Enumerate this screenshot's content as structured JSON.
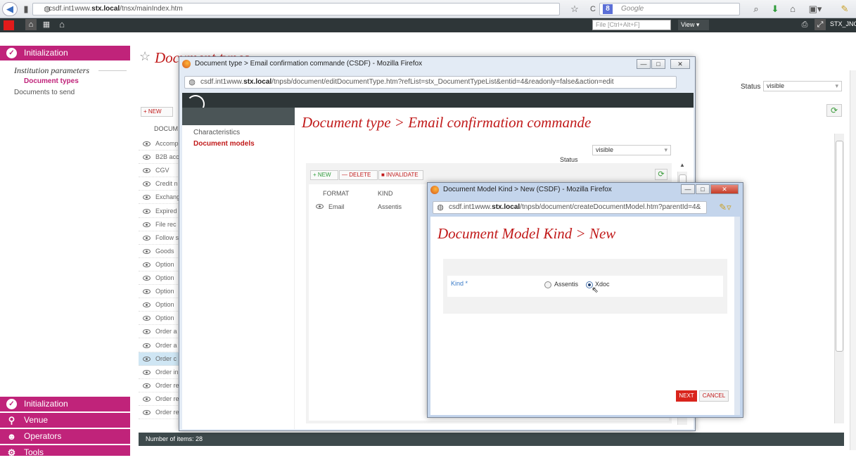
{
  "browser": {
    "url_prefix": "csdf.int1www.",
    "url_host": "stx.local",
    "url_path": "/tnsx/mainIndex.htm",
    "search_engine": "8",
    "search_placeholder": "Google",
    "star": "☆",
    "reload": "C"
  },
  "topbar": {
    "search_placeholder": "File [Ctrl+Alt+F]",
    "view_label": "View ▾",
    "user_label": "STX_JNO ▾"
  },
  "sidebar": {
    "section_title": "Initialization",
    "group_title": "Institution parameters",
    "items": [
      {
        "label": "Document types",
        "active": true
      },
      {
        "label": "Documents to send",
        "active": false
      }
    ],
    "bottom_sections": [
      "Initialization",
      "Venue",
      "Operators",
      "Tools"
    ]
  },
  "main": {
    "title": "Document types",
    "status_label": "Status",
    "status_value": "visible",
    "new_label": "+ NEW",
    "column_header": "DOCUM",
    "rows": [
      "Accomp",
      "B2B acc",
      "CGV",
      "Credit n",
      "Exchang",
      "Expired",
      "File rec",
      "Follow s",
      "Goods",
      "Option",
      "Option",
      "Option",
      "Option",
      "Option",
      "Order a",
      "Order a",
      "Order c",
      "Order in",
      "Order re",
      "Order re",
      "Order re"
    ],
    "footer": "Number of items: 28"
  },
  "window1": {
    "title": "Document type > Email confirmation commande (CSDF) - Mozilla Firefox",
    "url_prefix": "csdf.int1www.",
    "url_host": "stx.local",
    "url_path": "/tnpsb/document/editDocumentType.htm?refList=stx_DocumentTypeList&entid=4&readonly=false&action=edit",
    "nav": [
      {
        "label": "Characteristics",
        "active": false
      },
      {
        "label": "Document models",
        "active": true
      }
    ],
    "heading": "Document type > Email confirmation commande",
    "status_label": "Status",
    "status_value": "visible",
    "buttons": {
      "new": "+ NEW",
      "delete": "— DELETE",
      "invalidate": "■ INVALIDATE"
    },
    "columns": [
      "FORMAT",
      "KIND"
    ],
    "rows": [
      {
        "format": "Email",
        "kind": "Assentis"
      }
    ]
  },
  "window2": {
    "title": "Document Model Kind > New (CSDF) - Mozilla Firefox",
    "url_prefix": "csdf.int1www.",
    "url_host": "stx.local",
    "url_path": "/tnpsb/document/createDocumentModel.htm?parentId=4&",
    "heading": "Document Model Kind > New",
    "field_label": "Kind *",
    "options": [
      {
        "label": "Assentis",
        "checked": false
      },
      {
        "label": "Xdoc",
        "checked": true
      }
    ],
    "next_label": "NEXT",
    "cancel_label": "CANCEL"
  },
  "colors": {
    "accent": "#c0237a",
    "heading_red": "#c11a1a",
    "dark_bar": "#2e3638"
  }
}
